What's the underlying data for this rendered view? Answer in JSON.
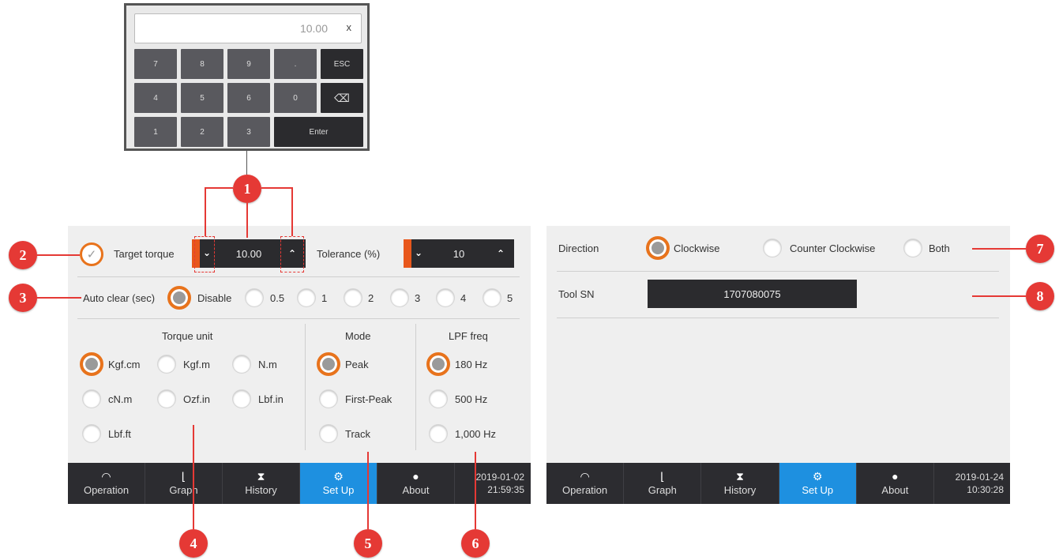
{
  "keypad": {
    "display_value": "10.00",
    "clear_label": "x",
    "keys": [
      "7",
      "8",
      "9",
      ".",
      "ESC",
      "4",
      "5",
      "6",
      "0",
      "⌫",
      "1",
      "2",
      "3",
      "Enter"
    ]
  },
  "panel1": {
    "target_torque_label": "Target torque",
    "target_torque_value": "10.00",
    "tolerance_label": "Tolerance (%)",
    "tolerance_value": "10",
    "auto_clear_label": "Auto clear (sec)",
    "auto_clear_options": [
      "Disable",
      "0.5",
      "1",
      "2",
      "3",
      "4",
      "5"
    ],
    "auto_clear_selected": "Disable",
    "torque_unit_title": "Torque unit",
    "torque_units": [
      "Kgf.cm",
      "Kgf.m",
      "N.m",
      "cN.m",
      "Ozf.in",
      "Lbf.in",
      "Lbf.ft"
    ],
    "torque_unit_selected": "Kgf.cm",
    "mode_title": "Mode",
    "modes": [
      "Peak",
      "First-Peak",
      "Track"
    ],
    "mode_selected": "Peak",
    "lpf_title": "LPF freq",
    "lpf_options": [
      "180 Hz",
      "500 Hz",
      "1,000 Hz"
    ],
    "lpf_selected": "180 Hz",
    "nav": [
      "Operation",
      "Graph",
      "History",
      "Set Up",
      "About"
    ],
    "nav_active": "Set Up",
    "date": "2019-01-02",
    "time": "21:59:35"
  },
  "panel2": {
    "direction_label": "Direction",
    "direction_options": [
      "Clockwise",
      "Counter Clockwise",
      "Both"
    ],
    "direction_selected": "Clockwise",
    "tool_sn_label": "Tool SN",
    "tool_sn_value": "1707080075",
    "nav": [
      "Operation",
      "Graph",
      "History",
      "Set Up",
      "About"
    ],
    "nav_active": "Set Up",
    "date": "2019-01-24",
    "time": "10:30:28"
  },
  "callouts": [
    "1",
    "2",
    "3",
    "4",
    "5",
    "6",
    "7",
    "8"
  ],
  "icons": {
    "operation": "gauge-icon",
    "graph": "chart-icon",
    "history": "hourglass-icon",
    "setup": "gears-icon",
    "about": "info-icon"
  },
  "colors": {
    "accent": "#e8731c",
    "callout": "#e53935",
    "nav_active": "#1e90e0",
    "nav_bg": "#2c2c30"
  }
}
